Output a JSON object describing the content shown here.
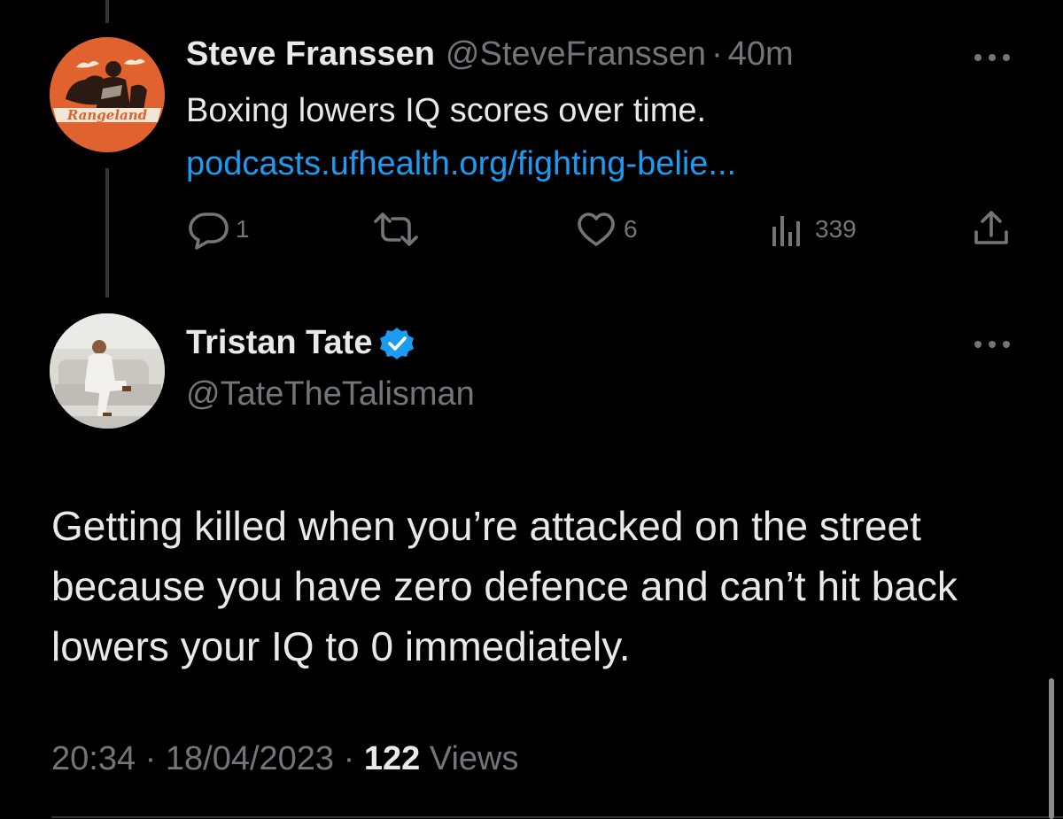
{
  "colors": {
    "background": "#000000",
    "text_primary": "#e7e9ea",
    "text_secondary": "#71767b",
    "link": "#1d9bf0",
    "verified_badge": "#1d9bf0"
  },
  "parent_tweet": {
    "author_name": "Steve Franssen",
    "author_handle": "@SteveFranssen",
    "separator": "·",
    "time_ago": "40m",
    "avatar_text": "Rangeland",
    "text": "Boxing lowers IQ scores over time.",
    "link": "podcasts.ufhealth.org/fighting-belie...",
    "actions": {
      "reply_icon": "reply-icon",
      "reply_count": "1",
      "retweet_icon": "retweet-icon",
      "retweet_count": "",
      "like_icon": "heart-icon",
      "like_count": "6",
      "views_icon": "views-chart-icon",
      "views_count": "339",
      "share_icon": "share-icon"
    }
  },
  "main_tweet": {
    "author_name": "Tristan Tate",
    "author_handle": "@TateTheTalisman",
    "verified": true,
    "text": "Getting killed when you’re attacked on the street because you have zero defence and can’t hit back lowers your IQ to 0 immediately.",
    "time": "20:34",
    "separator": "·",
    "date": "18/04/2023",
    "views_count": "122",
    "views_label": "Views"
  }
}
